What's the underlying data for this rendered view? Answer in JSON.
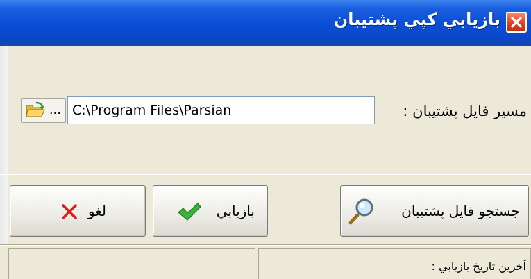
{
  "window": {
    "title": "بازيابي كپي پشتيبان"
  },
  "form": {
    "path_label": "مسير فايل پشتيبان :",
    "path_value": "C:\\Program Files\\Parsian",
    "browse_label": "..."
  },
  "buttons": {
    "search_label": "جستجو فايل پشتيبان",
    "restore_label": "بازيابي",
    "cancel_label": "لغو"
  },
  "status": {
    "last_restore_label": "آخرين تاريخ بازيابي :",
    "right_cell_text": "",
    "left_cell_text": ""
  },
  "colors": {
    "titlebar": "#0a47c6",
    "window_bg": "#ece9d8",
    "close_button": "#d8461f",
    "check_green": "#3bb33b",
    "cancel_red": "#e01b1b"
  },
  "icons": {
    "close": "close-icon",
    "folder": "folder-open-icon",
    "search": "magnifier-icon",
    "restore": "checkmark-icon",
    "cancel": "x-mark-icon"
  }
}
